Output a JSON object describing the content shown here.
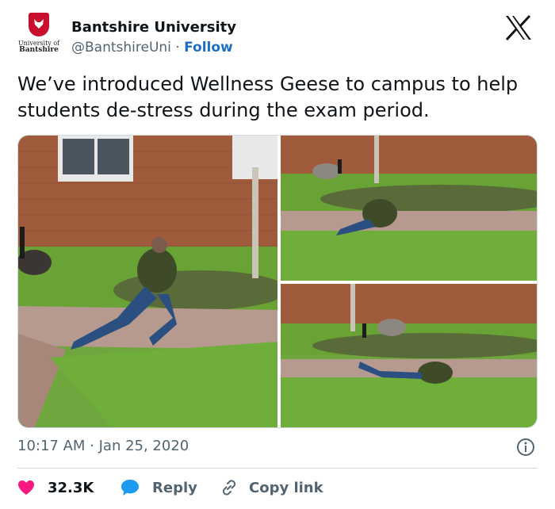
{
  "account": {
    "logo_line1": "University of",
    "logo_line2": "Bantshire",
    "name": "Bantshire University",
    "handle": "@BantshireUni",
    "separator": "·",
    "follow_label": "Follow"
  },
  "icons": {
    "brand": "x-logo-icon",
    "info": "info-icon",
    "like": "heart-icon",
    "reply": "speech-bubble-icon",
    "copy": "link-icon"
  },
  "tweet": {
    "text": "We’ve introduced Wellness Geese to campus to help students de-stress during the exam period.",
    "timestamp": "10:17 AM · Jan 25, 2020"
  },
  "actions": {
    "likes": "32.3K",
    "reply_label": "Reply",
    "copy_label": "Copy link"
  },
  "colors": {
    "accent": "#1d6fc4",
    "like": "#f91880",
    "reply": "#1d9bf0",
    "text": "#0f1419",
    "muted": "#536471",
    "brand_red": "#c8102e"
  }
}
